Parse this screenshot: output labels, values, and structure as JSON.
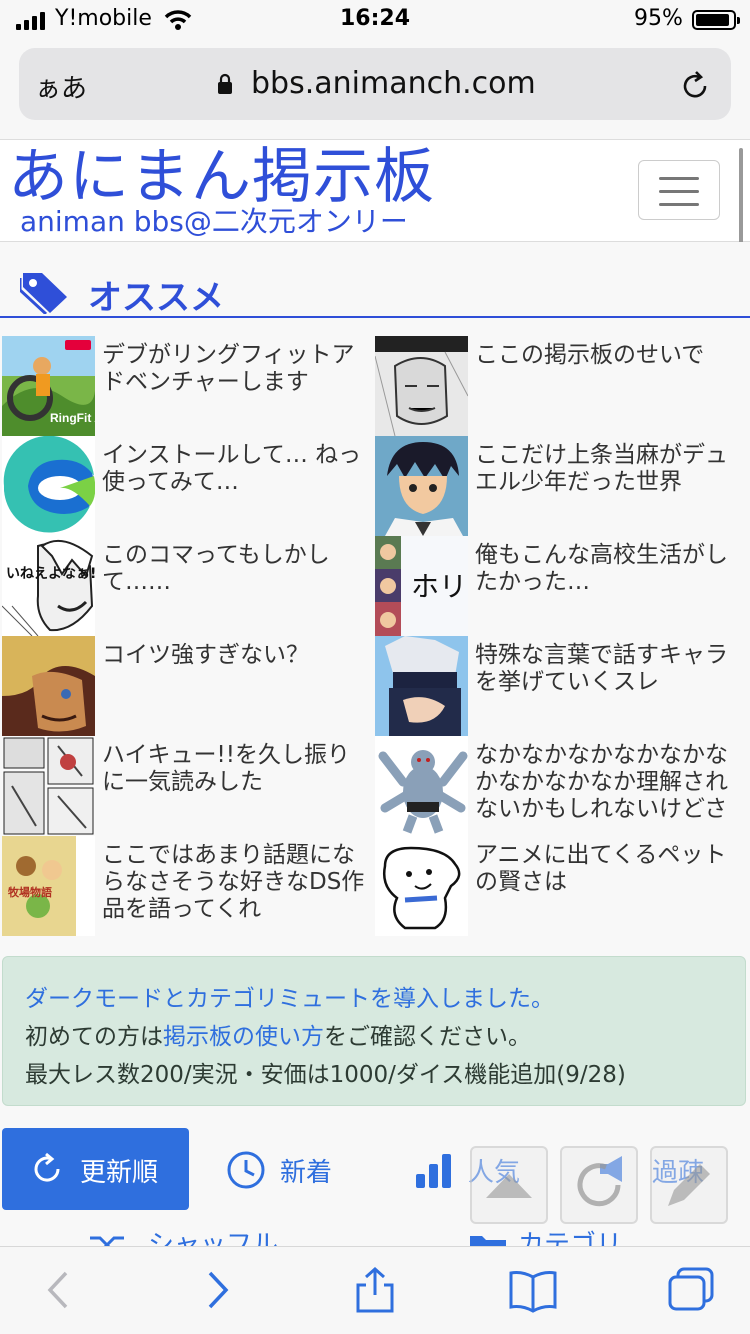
{
  "status_bar": {
    "carrier": "Y!mobile",
    "time": "16:24",
    "battery": "95%"
  },
  "browser": {
    "aa_label": "ぁあ",
    "url": "bbs.animanch.com"
  },
  "header": {
    "logo": "あにまん掲示板",
    "subtitle": "animan bbs@二次元オンリー"
  },
  "recommend": {
    "title": "オススメ",
    "items": [
      {
        "title": "デブがリングフィットアドベンチャーします",
        "thumb_text": "RingFit Adventure"
      },
      {
        "title": "ここの掲示板のせいで"
      },
      {
        "title": "インストールして… ねっ　使ってみて…"
      },
      {
        "title": "ここだけ上条当麻がデュエル少年だった世界"
      },
      {
        "title": "このコマってもしかして……",
        "thumb_text": "いねえよなぁ!!?"
      },
      {
        "title": "俺もこんな高校生活がしたかった…",
        "thumb_text": "ホリ"
      },
      {
        "title": "コイツ強すぎない？"
      },
      {
        "title": "特殊な言葉で話すキャラを挙げていくスレ"
      },
      {
        "title": "ハイキュー!!を久し振りに一気読みした"
      },
      {
        "title": "なかなかなかなかなかなかなかなかなか理解されないかもしれないけどさ"
      },
      {
        "title": "ここではあまり話題にならなさそうな好きなDS作品を語ってくれ",
        "thumb_text": "牧場物語"
      },
      {
        "title": "アニメに出てくるペットの賢さは"
      }
    ]
  },
  "notice": {
    "line1": "ダークモードとカテゴリミュートを導入しました。",
    "line2_prefix": "初めての方は",
    "line2_link": "掲示板の使い方",
    "line2_suffix": "をご確認ください。",
    "line3": "最大レス数200/実況・安価は1000/ダイス機能追加(9/28)"
  },
  "tabs": {
    "updated": "更新順",
    "new": "新着",
    "popular": "人気",
    "hot": "過疎",
    "shuffle": "シャッフル",
    "category": "カテゴリ"
  },
  "colors": {
    "brand": "#2f4fd8",
    "accent": "#2f6fde",
    "notice_bg": "#d7e9df"
  }
}
